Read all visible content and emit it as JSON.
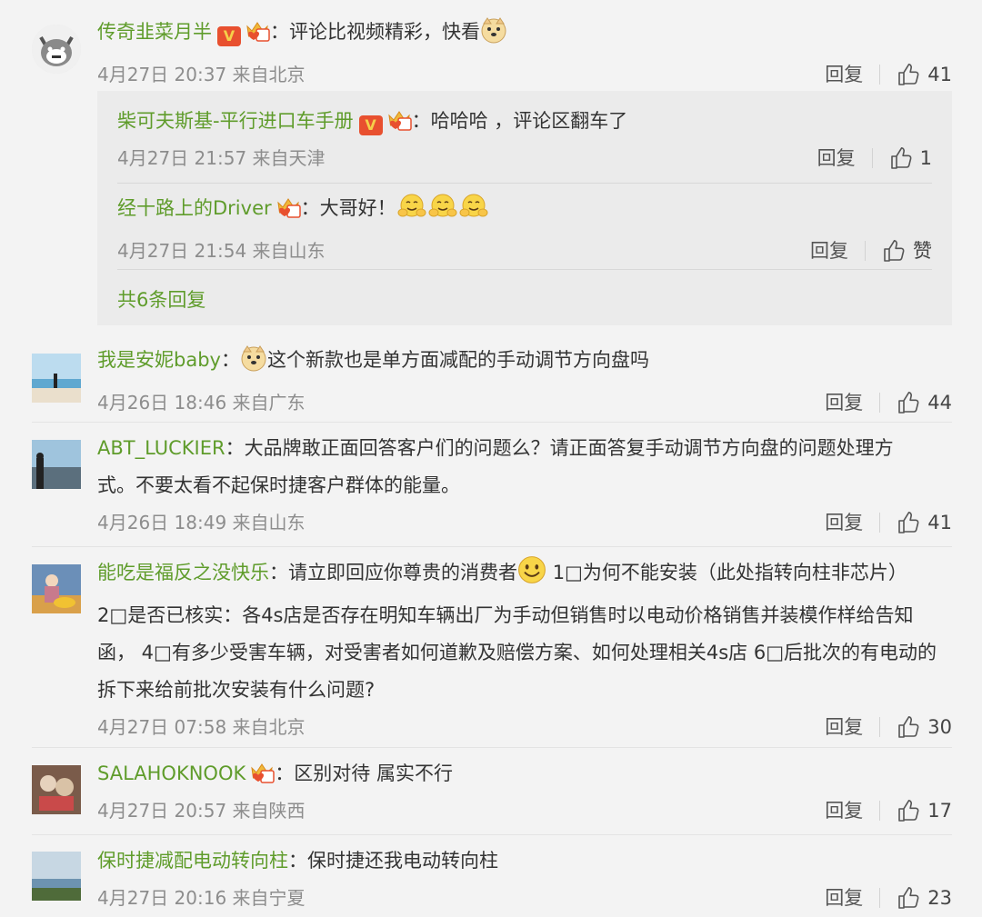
{
  "comments": [
    {
      "username": "传奇韭菜月半",
      "content": "评论比视频精彩，快看",
      "time": "4月27日 20:37 来自北京",
      "reply_label": "回复",
      "likes": "41",
      "replies": [
        {
          "username": "柴可夫斯基-平行进口车手册",
          "content": "哈哈哈 ，评论区翻车了",
          "time": "4月27日 21:57 来自天津",
          "reply_label": "回复",
          "likes": "1"
        },
        {
          "username": "经十路上的Driver",
          "content": "大哥好！",
          "time": "4月27日 21:54 来自山东",
          "reply_label": "回复",
          "likes": "赞"
        }
      ],
      "more_replies": "共6条回复"
    },
    {
      "username": "我是安妮baby",
      "content": "这个新款也是单方面减配的手动调节方向盘吗",
      "time": "4月26日 18:46 来自广东",
      "reply_label": "回复",
      "likes": "44"
    },
    {
      "username": "ABT_LUCKIER",
      "content": "大品牌敢正面回答客户们的问题么？请正面答复手动调节方向盘的问题处理方",
      "content_2": "式。不要太看不起保时捷客户群体的能量。",
      "time": "4月26日 18:49 来自山东",
      "reply_label": "回复",
      "likes": "41"
    },
    {
      "username": "能吃是福反之没快乐",
      "content": "请立即回应你尊贵的消费者",
      "content_a": "1□为何不能安装（此处指转向柱非芯片）",
      "content_2": "2□是否已核实：各4s店是否存在明知车辆出厂为手动但销售时以电动价格销售并装模作样给告知",
      "content_3": "函， 4□有多少受害车辆，对受害者如何道歉及赔偿方案、如何处理相关4s店 6□后批次的有电动的",
      "content_4": "拆下来给前批次安装有什么问题?",
      "time": "4月27日 07:58 来自北京",
      "reply_label": "回复",
      "likes": "30"
    },
    {
      "username": "SALAHOKNOOK",
      "content": "区别对待 属实不行",
      "time": "4月27日 20:57 来自陕西",
      "reply_label": "回复",
      "likes": "17"
    },
    {
      "username": "保时捷减配电动转向柱",
      "content": "保时捷还我电动转向柱",
      "time": "4月27日 20:16 来自宁夏",
      "reply_label": "回复",
      "likes": "23"
    }
  ],
  "colon": "：",
  "badge_v": "V",
  "colors": {
    "username": "#5f9c2b",
    "text": "#333333",
    "meta": "#8d8d8d",
    "background": "#f3f3f3"
  },
  "icons": [
    "thumbs-up-icon",
    "verified-v-icon",
    "fan-crown-icon",
    "doge-emoji-icon",
    "smile-emoji-icon"
  ]
}
